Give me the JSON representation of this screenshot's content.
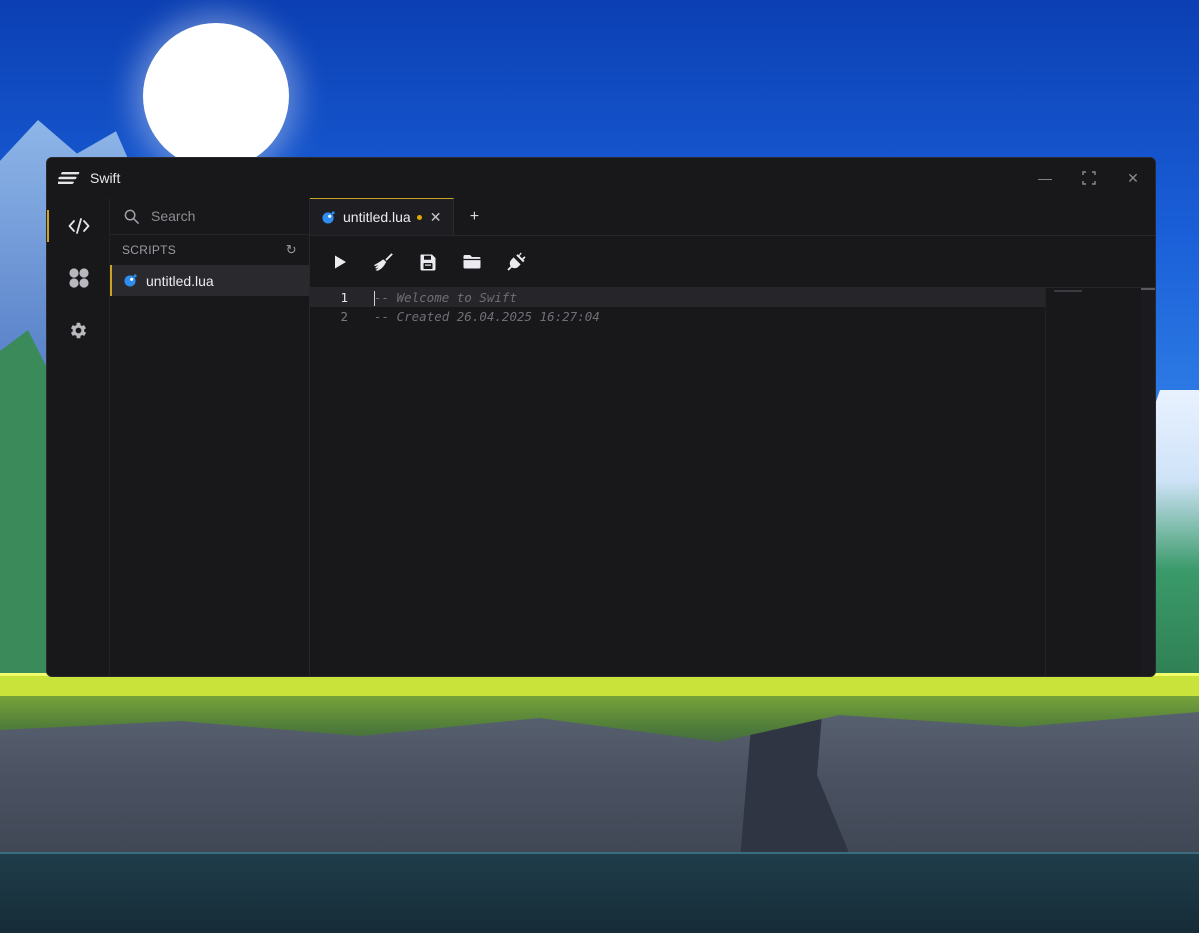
{
  "app": {
    "title": "Swift"
  },
  "window_controls": {
    "minimize": "—",
    "maximize": "⛶",
    "close": "✕"
  },
  "activity_bar": [
    {
      "name": "editor",
      "icon": "code-icon",
      "active": true
    },
    {
      "name": "scripts-hub",
      "icon": "grid-icon",
      "active": false
    },
    {
      "name": "settings",
      "icon": "gear-icon",
      "active": false
    }
  ],
  "explorer": {
    "search_placeholder": "Search",
    "section_title": "SCRIPTS",
    "refresh_icon": "↻",
    "files": [
      {
        "label": "untitled.lua",
        "icon": "lua-icon",
        "selected": true
      }
    ]
  },
  "tabs": [
    {
      "label": "untitled.lua",
      "icon": "lua-icon",
      "dirty": true,
      "close": "✕"
    }
  ],
  "add_tab": "+",
  "toolbar": [
    {
      "name": "execute",
      "icon": "play-icon"
    },
    {
      "name": "clear",
      "icon": "broom-icon"
    },
    {
      "name": "save",
      "icon": "save-icon"
    },
    {
      "name": "open",
      "icon": "folder-icon"
    },
    {
      "name": "attach",
      "icon": "plug-icon"
    }
  ],
  "editor": {
    "lines": [
      {
        "number": "1",
        "text": "-- Welcome to Swift"
      },
      {
        "number": "2",
        "text": "-- Created 26.04.2025 16:27:04"
      }
    ]
  },
  "colors": {
    "accent": "#c9a227",
    "window_bg": "#18181b",
    "lua_icon": "#2f8cf0",
    "dirty_dot": "#e0a800"
  }
}
